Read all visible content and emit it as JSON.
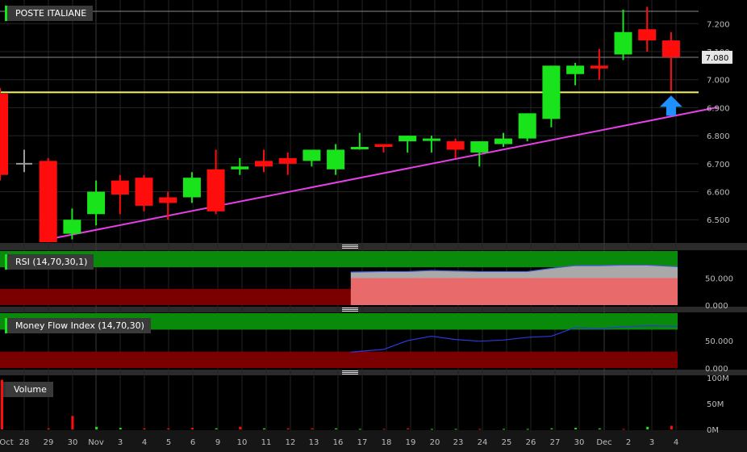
{
  "chart_data": [
    {
      "type": "candlestick",
      "title": "POSTE ITALIANE",
      "x_tick_labels": [
        "Oct",
        "28",
        "29",
        "30",
        "Nov",
        "3",
        "4",
        "5",
        "6",
        "9",
        "10",
        "11",
        "12",
        "13",
        "16",
        "17",
        "18",
        "19",
        "20",
        "23",
        "24",
        "25",
        "26",
        "27",
        "30",
        "Dec",
        "2",
        "3",
        "4"
      ],
      "y_tick_labels": [
        "7.200",
        "7.100",
        "7.000",
        "6.900",
        "6.800",
        "6.700",
        "6.600",
        "6.500"
      ],
      "ylim": [
        6.42,
        7.27
      ],
      "last_price": "7.080",
      "support_level": 6.955,
      "trendline": [
        [
          1,
          6.43
        ],
        [
          28,
          6.89
        ]
      ],
      "up_color": "#19e31a",
      "down_color": "#ff0d0d",
      "candles": [
        {
          "i": -1,
          "o": 6.95,
          "h": 6.97,
          "l": 6.64,
          "c": 6.66
        },
        {
          "i": 0,
          "o": 6.7,
          "h": 6.75,
          "l": 6.67,
          "c": 6.7
        },
        {
          "i": 1,
          "o": 6.71,
          "h": 6.72,
          "l": 6.42,
          "c": 6.42
        },
        {
          "i": 2,
          "o": 6.45,
          "h": 6.54,
          "l": 6.43,
          "c": 6.5
        },
        {
          "i": 3,
          "o": 6.52,
          "h": 6.64,
          "l": 6.48,
          "c": 6.6
        },
        {
          "i": 4,
          "o": 6.64,
          "h": 6.66,
          "l": 6.52,
          "c": 6.59
        },
        {
          "i": 5,
          "o": 6.65,
          "h": 6.66,
          "l": 6.53,
          "c": 6.55
        },
        {
          "i": 6,
          "o": 6.58,
          "h": 6.6,
          "l": 6.5,
          "c": 6.56
        },
        {
          "i": 7,
          "o": 6.58,
          "h": 6.67,
          "l": 6.56,
          "c": 6.65
        },
        {
          "i": 8,
          "o": 6.68,
          "h": 6.75,
          "l": 6.52,
          "c": 6.53
        },
        {
          "i": 9,
          "o": 6.68,
          "h": 6.72,
          "l": 6.66,
          "c": 6.69
        },
        {
          "i": 10,
          "o": 6.71,
          "h": 6.75,
          "l": 6.67,
          "c": 6.69
        },
        {
          "i": 11,
          "o": 6.72,
          "h": 6.74,
          "l": 6.66,
          "c": 6.7
        },
        {
          "i": 12,
          "o": 6.71,
          "h": 6.75,
          "l": 6.69,
          "c": 6.75
        },
        {
          "i": 13,
          "o": 6.68,
          "h": 6.77,
          "l": 6.66,
          "c": 6.75
        },
        {
          "i": 14,
          "o": 6.76,
          "h": 6.81,
          "l": 6.75,
          "c": 6.76
        },
        {
          "i": 15,
          "o": 6.77,
          "h": 6.77,
          "l": 6.74,
          "c": 6.76
        },
        {
          "i": 16,
          "o": 6.78,
          "h": 6.8,
          "l": 6.74,
          "c": 6.8
        },
        {
          "i": 17,
          "o": 6.79,
          "h": 6.8,
          "l": 6.74,
          "c": 6.79
        },
        {
          "i": 18,
          "o": 6.78,
          "h": 6.79,
          "l": 6.72,
          "c": 6.75
        },
        {
          "i": 19,
          "o": 6.74,
          "h": 6.78,
          "l": 6.69,
          "c": 6.78
        },
        {
          "i": 20,
          "o": 6.77,
          "h": 6.81,
          "l": 6.76,
          "c": 6.79
        },
        {
          "i": 21,
          "o": 6.79,
          "h": 6.88,
          "l": 6.78,
          "c": 6.88
        },
        {
          "i": 22,
          "o": 6.86,
          "h": 7.05,
          "l": 6.83,
          "c": 7.05
        },
        {
          "i": 23,
          "o": 7.02,
          "h": 7.06,
          "l": 6.98,
          "c": 7.05
        },
        {
          "i": 24,
          "o": 7.05,
          "h": 7.11,
          "l": 7.0,
          "c": 7.04
        },
        {
          "i": 25,
          "o": 7.09,
          "h": 7.25,
          "l": 7.07,
          "c": 7.17
        },
        {
          "i": 26,
          "o": 7.18,
          "h": 7.26,
          "l": 7.1,
          "c": 7.14
        },
        {
          "i": 27,
          "o": 7.14,
          "h": 7.17,
          "l": 6.96,
          "c": 7.08
        }
      ]
    },
    {
      "type": "area",
      "title": "RSI (14,70,30,1)",
      "y_tick_labels": [
        "50.000",
        "0.000"
      ],
      "ylim": [
        0,
        100
      ],
      "overbought": 70,
      "oversold": 30,
      "x_index": [
        14,
        15,
        16,
        17,
        18,
        19,
        20,
        21,
        22,
        23,
        24,
        25,
        26,
        27
      ],
      "values": [
        61,
        62,
        62,
        64,
        63,
        62,
        62,
        62,
        68,
        73,
        73,
        74,
        74,
        71
      ]
    },
    {
      "type": "line",
      "title": "Money Flow Index (14,70,30)",
      "y_tick_labels": [
        "50.000",
        "0.000"
      ],
      "ylim": [
        0,
        100
      ],
      "overbought": 70,
      "oversold": 30,
      "x_index": [
        14,
        15,
        16,
        17,
        18,
        19,
        20,
        21,
        22,
        23,
        24,
        25,
        26,
        27
      ],
      "values": [
        29,
        34,
        50,
        58,
        52,
        49,
        51,
        56,
        58,
        74,
        72,
        75,
        77,
        76
      ]
    },
    {
      "type": "bar",
      "title": "Volume",
      "y_tick_labels": [
        "100M",
        "50M",
        "0M"
      ],
      "ylim": [
        0,
        100
      ],
      "x_index": [
        -1,
        1,
        2,
        3,
        4,
        5,
        6,
        7,
        8,
        9,
        10,
        11,
        12,
        13,
        14,
        15,
        16,
        17,
        18,
        19,
        20,
        21,
        22,
        23,
        24,
        25,
        26,
        27
      ],
      "values": [
        96,
        2,
        26,
        5,
        3,
        2,
        2,
        3,
        2,
        5,
        2,
        2,
        2,
        2,
        1,
        1,
        2,
        1,
        1,
        1,
        1,
        1,
        2,
        3,
        2,
        1,
        5,
        7
      ],
      "colors": [
        "down",
        "down",
        "down",
        "up",
        "up",
        "down",
        "down",
        "down",
        "up",
        "down",
        "up",
        "down",
        "down",
        "up",
        "up",
        "down",
        "down",
        "up",
        "up",
        "down",
        "up",
        "up",
        "up",
        "up",
        "up",
        "down",
        "up",
        "down"
      ]
    }
  ]
}
